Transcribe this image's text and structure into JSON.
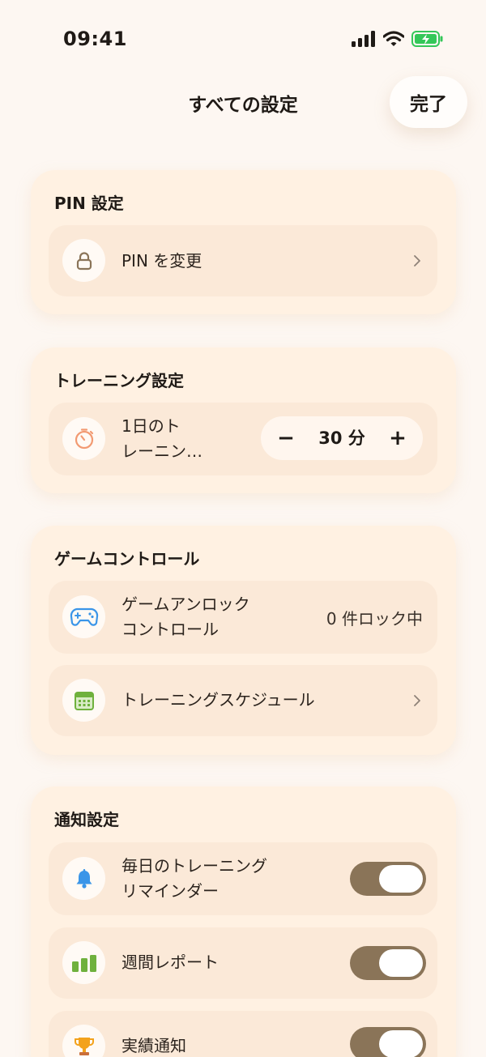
{
  "status_bar": {
    "time": "09:41"
  },
  "header": {
    "title": "すべての設定",
    "done_label": "完了"
  },
  "pin_section": {
    "title": "PIN 設定",
    "items": [
      {
        "label": "PIN を変更",
        "icon": "lock-icon"
      }
    ]
  },
  "training_section": {
    "title": "トレーニング設定",
    "daily_training": {
      "label_line1": "1日のト",
      "label_line2": "レーニン…",
      "icon": "timer-icon",
      "minus_label": "−",
      "plus_label": "+",
      "value": "30 分"
    }
  },
  "game_section": {
    "title": "ゲームコントロール",
    "items": [
      {
        "label_line1": "ゲームアンロック",
        "label_line2": "コントロール",
        "value": "0 件ロック中",
        "icon": "gamepad-icon"
      },
      {
        "label": "トレーニングスケジュール",
        "icon": "calendar-icon"
      }
    ]
  },
  "notification_section": {
    "title": "通知設定",
    "items": [
      {
        "label_line1": "毎日のトレーニング",
        "label_line2": "リマインダー",
        "icon": "bell-icon",
        "enabled": true
      },
      {
        "label": "週間レポート",
        "icon": "bar-chart-icon",
        "enabled": true
      },
      {
        "label": "実績通知",
        "icon": "trophy-icon",
        "enabled": true
      }
    ]
  },
  "colors": {
    "background": "#fdf7f2",
    "card": "#fff1e2",
    "row": "#fbe9d8",
    "toggle_on": "#8a7458",
    "battery": "#34c759",
    "bell": "#3a95e8",
    "chart": "#6fb13d",
    "trophy": "#f3a21c",
    "timer": "#f29a72"
  }
}
